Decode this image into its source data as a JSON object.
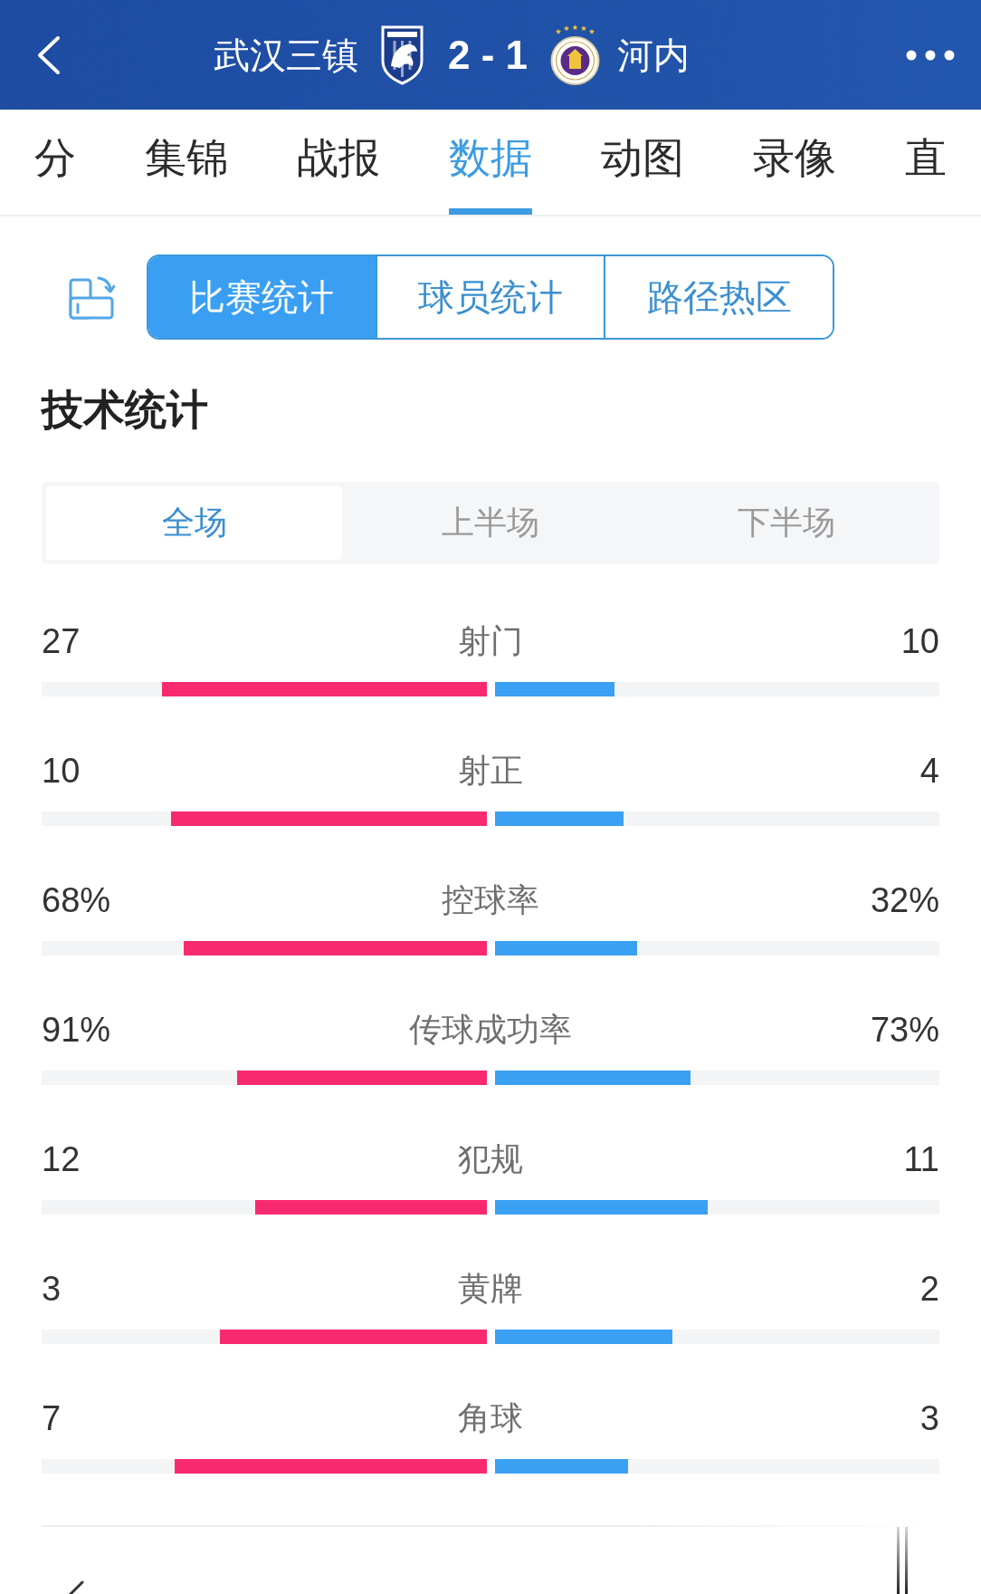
{
  "header": {
    "home_team": "武汉三镇",
    "score": "2 - 1",
    "away_team": "河内"
  },
  "tabs": [
    {
      "label": "分",
      "selected": false
    },
    {
      "label": "集锦",
      "selected": false
    },
    {
      "label": "战报",
      "selected": false
    },
    {
      "label": "数据",
      "selected": true
    },
    {
      "label": "动图",
      "selected": false
    },
    {
      "label": "录像",
      "selected": false
    },
    {
      "label": "直",
      "selected": false
    }
  ],
  "view_switch": [
    {
      "label": "比赛统计",
      "selected": true
    },
    {
      "label": "球员统计",
      "selected": false
    },
    {
      "label": "路径热区",
      "selected": false
    }
  ],
  "section": {
    "title": "技术统计",
    "periods": [
      {
        "label": "全场",
        "selected": true
      },
      {
        "label": "上半场",
        "selected": false
      },
      {
        "label": "下半场",
        "selected": false
      }
    ],
    "stats": [
      {
        "name": "射门",
        "home": {
          "value": "27",
          "level": 0.73
        },
        "away": {
          "value": "10",
          "level": 0.27
        }
      },
      {
        "name": "射正",
        "home": {
          "value": "10",
          "level": 0.71
        },
        "away": {
          "value": "4",
          "level": 0.29
        }
      },
      {
        "name": "控球率",
        "home": {
          "value": "68%",
          "level": 0.68
        },
        "away": {
          "value": "32%",
          "level": 0.32
        }
      },
      {
        "name": "传球成功率",
        "home": {
          "value": "91%",
          "level": 0.56
        },
        "away": {
          "value": "73%",
          "level": 0.44
        }
      },
      {
        "name": "犯规",
        "home": {
          "value": "12",
          "level": 0.52
        },
        "away": {
          "value": "11",
          "level": 0.48
        }
      },
      {
        "name": "黄牌",
        "home": {
          "value": "3",
          "level": 0.6
        },
        "away": {
          "value": "2",
          "level": 0.4
        }
      },
      {
        "name": "角球",
        "home": {
          "value": "7",
          "level": 0.7
        },
        "away": {
          "value": "3",
          "level": 0.3
        }
      }
    ]
  }
}
